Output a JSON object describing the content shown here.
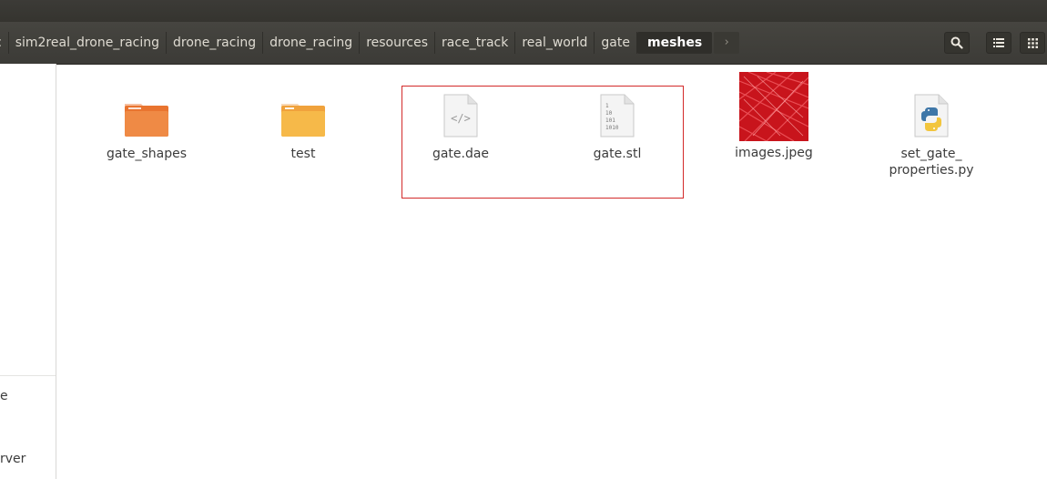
{
  "breadcrumbs": [
    {
      "label": "c"
    },
    {
      "label": "sim2real_drone_racing"
    },
    {
      "label": "drone_racing"
    },
    {
      "label": "drone_racing"
    },
    {
      "label": "resources"
    },
    {
      "label": "race_track"
    },
    {
      "label": "real_world"
    },
    {
      "label": "gate"
    }
  ],
  "current_folder": "meshes",
  "header_icons": {
    "more": "chevron-right-icon",
    "search": "search-icon",
    "list_view": "list-view-icon",
    "grid_view": "grid-view-icon"
  },
  "sidebar": {
    "items": [
      {
        "label": "e"
      },
      {
        "label": "rver"
      }
    ]
  },
  "files": [
    {
      "name": "gate_shapes",
      "icon": "folder-icon"
    },
    {
      "name": "test",
      "icon": "folder-open-icon"
    },
    {
      "name": "gate.dae",
      "icon": "xml-file-icon"
    },
    {
      "name": "gate.stl",
      "icon": "binary-file-icon"
    },
    {
      "name": "images.jpeg",
      "icon": "image-thumbnail-icon"
    },
    {
      "name": "set_gate_\nproperties.py",
      "icon": "python-file-icon"
    }
  ],
  "colors": {
    "header_bg": "#3c3b37",
    "folder_orange": "#e9742f",
    "selection_box": "#d32a2a"
  }
}
